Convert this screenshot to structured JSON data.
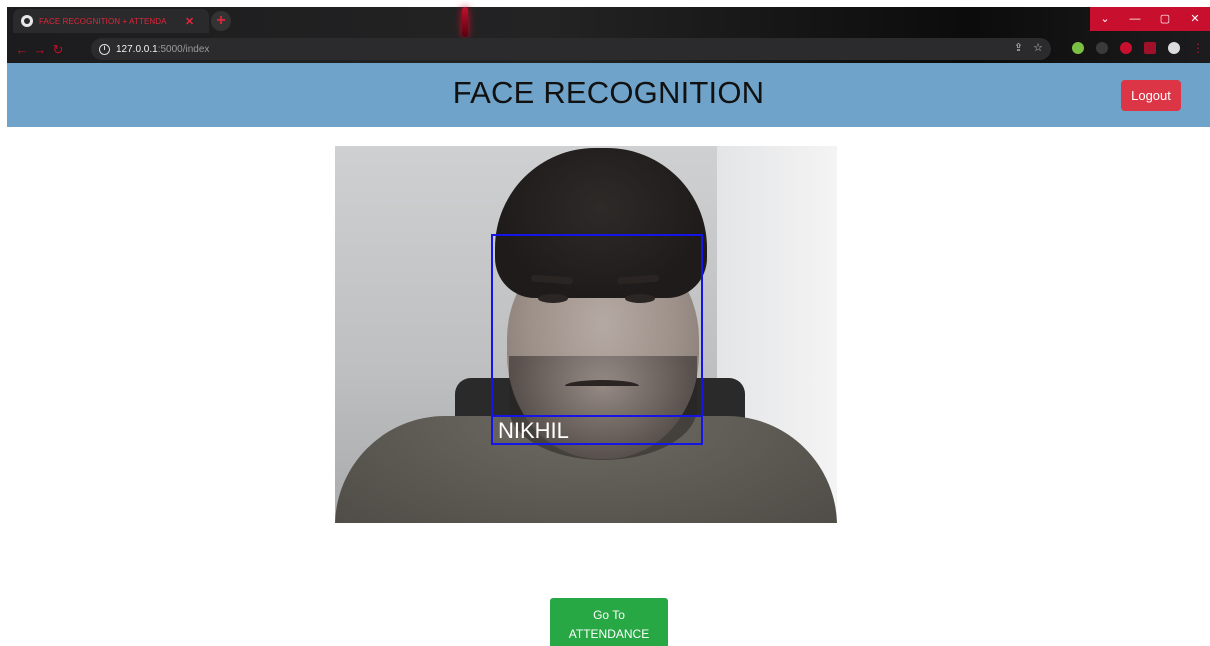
{
  "browser": {
    "tab_title": "FACE RECOGNITION + ATTENDA",
    "tab_close": "✕",
    "new_tab": "+",
    "url_host": "127.0.0.1",
    "url_path": ":5000/index",
    "window_controls": [
      "⌄",
      "—",
      "▢",
      "✕"
    ]
  },
  "header": {
    "title": "FACE RECOGNITION",
    "logout_label": "Logout",
    "background_color": "#6fa3c9",
    "logout_color": "#dc3545"
  },
  "feed": {
    "detected_name": "NIKHIL",
    "box_color": "#1515e6"
  },
  "actions": {
    "attendance_line1": "Go To",
    "attendance_line2": "ATTENDANCE",
    "attendance_color": "#28a745"
  }
}
